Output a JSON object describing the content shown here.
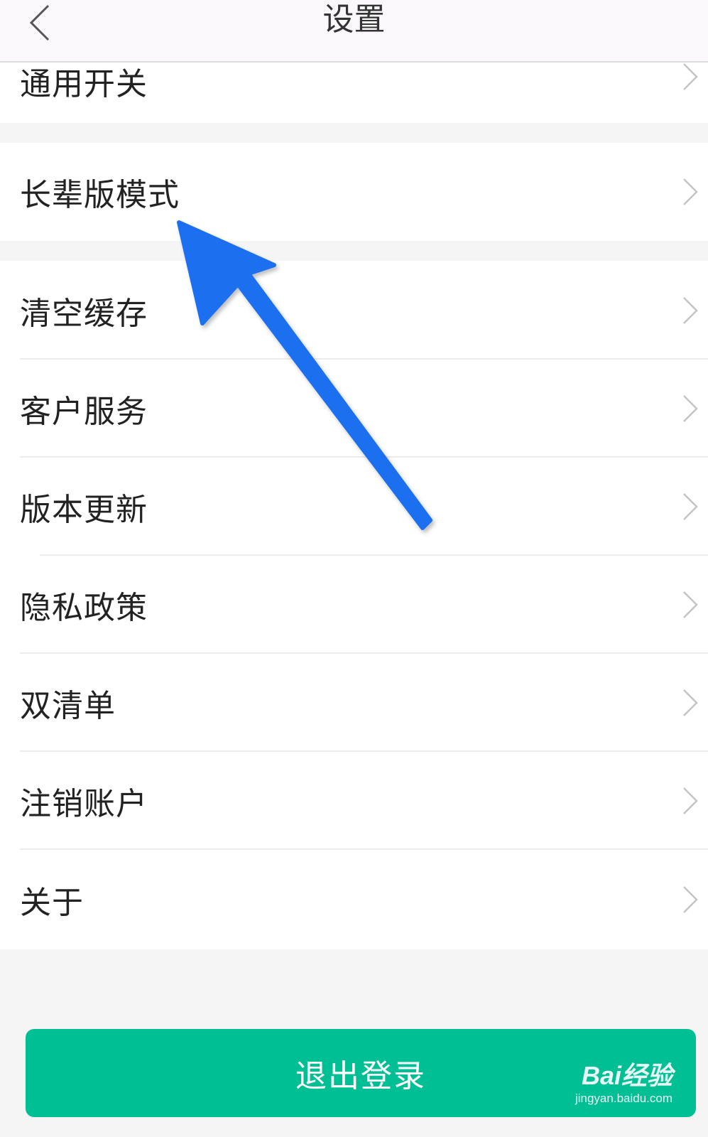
{
  "header": {
    "title": "设置",
    "back_icon": "chevron-left-icon"
  },
  "sections": [
    {
      "items": [
        {
          "label": "通用开关"
        }
      ]
    },
    {
      "items": [
        {
          "label": "长辈版模式"
        }
      ]
    },
    {
      "items": [
        {
          "label": "清空缓存"
        },
        {
          "label": "客户服务"
        },
        {
          "label": "版本更新"
        },
        {
          "label": "隐私政策"
        },
        {
          "label": "双清单"
        },
        {
          "label": "注销账户"
        },
        {
          "label": "关于"
        }
      ]
    }
  ],
  "logout": {
    "label": "退出登录"
  },
  "watermark": {
    "brand": "Bai经验",
    "url": "jingyan.baidu.com"
  },
  "colors": {
    "accent": "#00bf94",
    "arrow": "#1a6ff0",
    "header_bg": "#fbf8fb",
    "page_bg": "#f5f5f5"
  }
}
